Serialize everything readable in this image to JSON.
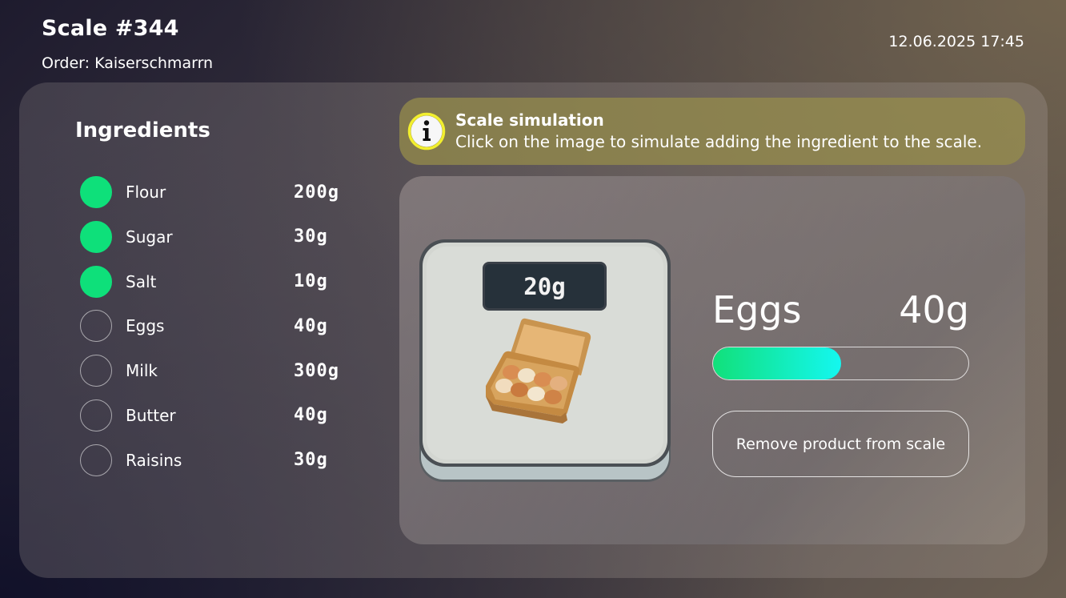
{
  "header": {
    "title": "Scale #344",
    "order": "Order: Kaiserschmarrn",
    "datetime": "12.06.2025 17:45"
  },
  "ingredients": {
    "heading": "Ingredients",
    "items": [
      {
        "name": "Flour",
        "amount": "200g",
        "done": true
      },
      {
        "name": "Sugar",
        "amount": "30g",
        "done": true
      },
      {
        "name": "Salt",
        "amount": "10g",
        "done": true
      },
      {
        "name": "Eggs",
        "amount": "40g",
        "done": false
      },
      {
        "name": "Milk",
        "amount": "300g",
        "done": false
      },
      {
        "name": "Butter",
        "amount": "40g",
        "done": false
      },
      {
        "name": "Raisins",
        "amount": "30g",
        "done": false
      }
    ]
  },
  "info": {
    "icon": "info-icon",
    "title": "Scale simulation",
    "body": "Click on the image to simulate adding the ingredient to the scale."
  },
  "scale": {
    "reading": "20g",
    "product_icon": "egg-carton-icon"
  },
  "current_product": {
    "name": "Eggs",
    "target": "40g",
    "progress_fraction": 0.5
  },
  "remove_button_label": "Remove product from scale",
  "colors": {
    "done": "#0ee07a",
    "progress_start": "#11e07a",
    "progress_end": "#14f7f0",
    "info_accent": "#f2ef2e"
  }
}
